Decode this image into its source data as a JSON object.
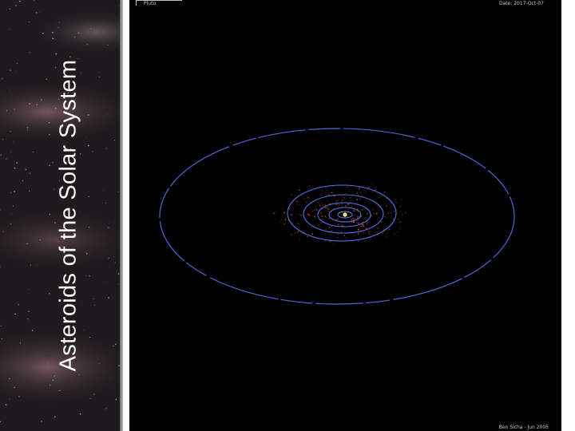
{
  "slide": {
    "title": "Asteroids of the Solar System"
  },
  "simulation": {
    "object_label": "Pluto",
    "date_label": "Date: 2017-Oct-07",
    "footer_label": "Ben Sicha - Jun 2005",
    "colors": {
      "background": "#000000",
      "pluto_orbit": "#4d67d6",
      "planet_orbits": "#4f74e6",
      "asteroids": "#c0442a",
      "sun": "#ffe27a"
    }
  }
}
